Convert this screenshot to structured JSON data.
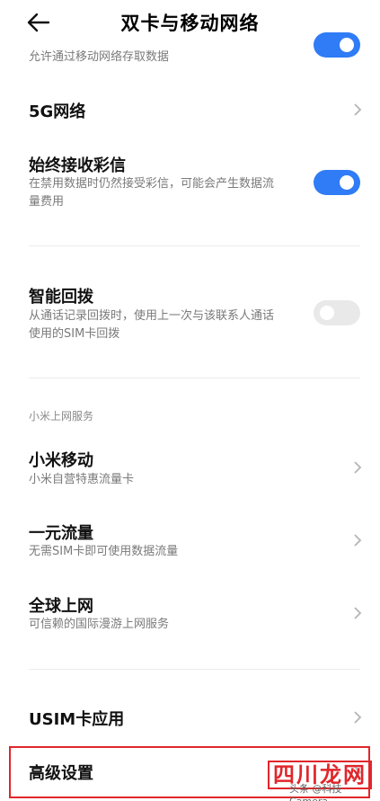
{
  "header": {
    "title": "双卡与移动网络"
  },
  "top_partial": {
    "subtitle": "允许通过移动网络存取数据"
  },
  "items": {
    "fiveg": {
      "title": "5G网络"
    },
    "mms": {
      "title": "始终接收彩信",
      "sub1": "在禁用数据时仍然接受彩信，可能会产生数据流",
      "sub2": "量费用",
      "toggle": "on"
    },
    "redial": {
      "title": "智能回拨",
      "sub1": "从通话记录回拨时，使用上一次与该联系人通话",
      "sub2": "使用的SIM卡回拨",
      "toggle": "off"
    },
    "section_label": "小米上网服务",
    "mimobile": {
      "title": "小米移动",
      "sub": "小米自营特惠流量卡"
    },
    "oneyuan": {
      "title": "一元流量",
      "sub": "无需SIM卡即可使用数据流量"
    },
    "global": {
      "title": "全球上网",
      "sub": "可信赖的国际漫游上网服务"
    },
    "usim": {
      "title": "USIM卡应用"
    },
    "advanced": {
      "title": "高级设置"
    }
  },
  "watermark": {
    "logo": "四川龙网",
    "credit": "头条 @科技Camera"
  },
  "colors": {
    "accent": "#2f7cf6",
    "highlight": "#e0262b"
  }
}
